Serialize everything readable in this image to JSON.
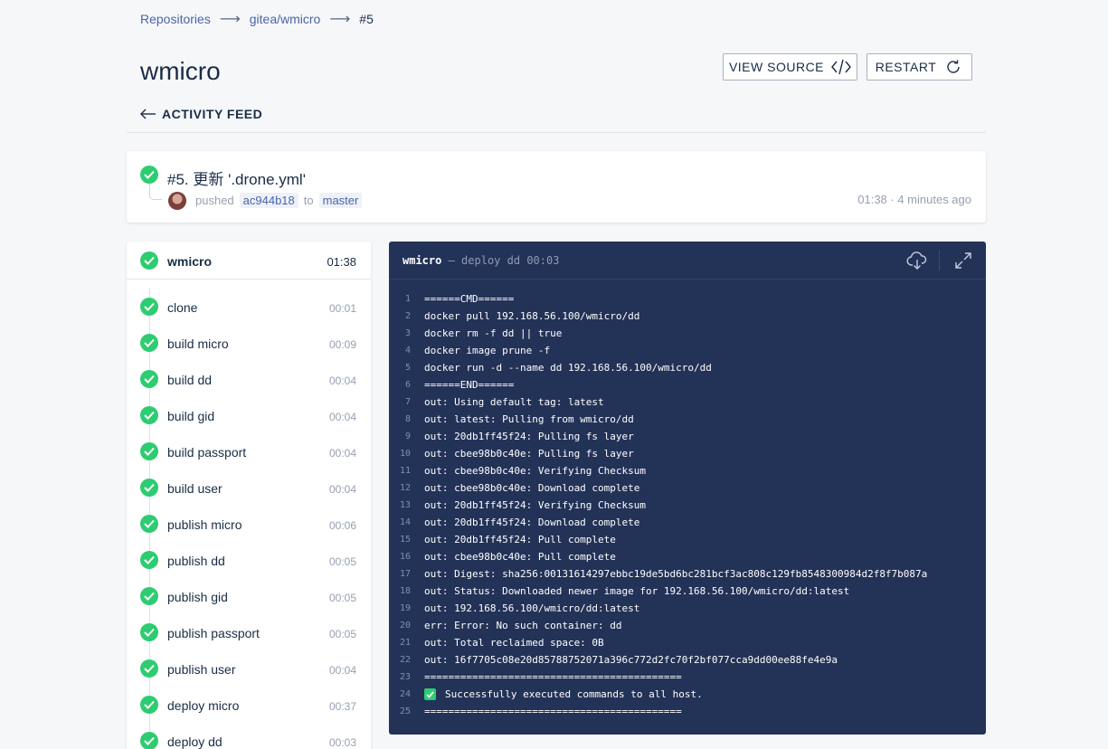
{
  "breadcrumb": {
    "repositories": "Repositories",
    "repo": "gitea/wmicro",
    "build": "#5"
  },
  "repo_name": "wmicro",
  "actions": {
    "view_source": "VIEW SOURCE",
    "restart": "RESTART"
  },
  "back_label": "ACTIVITY FEED",
  "build": {
    "title": "#5. 更新 '.drone.yml'",
    "action": "pushed",
    "commit": "ac944b18",
    "to": "to",
    "branch": "master",
    "duration": "01:38",
    "ago": "4 minutes ago",
    "time_text": "01:38 · 4 minutes ago"
  },
  "stage": {
    "name": "wmicro",
    "duration": "01:38"
  },
  "steps": [
    {
      "name": "clone",
      "duration": "00:01"
    },
    {
      "name": "build micro",
      "duration": "00:09"
    },
    {
      "name": "build dd",
      "duration": "00:04"
    },
    {
      "name": "build gid",
      "duration": "00:04"
    },
    {
      "name": "build passport",
      "duration": "00:04"
    },
    {
      "name": "build user",
      "duration": "00:04"
    },
    {
      "name": "publish micro",
      "duration": "00:06"
    },
    {
      "name": "publish dd",
      "duration": "00:05"
    },
    {
      "name": "publish gid",
      "duration": "00:05"
    },
    {
      "name": "publish passport",
      "duration": "00:05"
    },
    {
      "name": "publish user",
      "duration": "00:04"
    },
    {
      "name": "deploy micro",
      "duration": "00:37"
    },
    {
      "name": "deploy dd",
      "duration": "00:03"
    }
  ],
  "log": {
    "stage": "wmicro",
    "separator": " — ",
    "step": "deploy dd",
    "duration": "00:03",
    "lines": [
      "======CMD======",
      "docker pull 192.168.56.100/wmicro/dd",
      "docker rm -f dd || true",
      "docker image prune -f",
      "docker run -d --name dd 192.168.56.100/wmicro/dd",
      "======END======",
      "out: Using default tag: latest",
      "out: latest: Pulling from wmicro/dd",
      "out: 20db1ff45f24: Pulling fs layer",
      "out: cbee98b0c40e: Pulling fs layer",
      "out: cbee98b0c40e: Verifying Checksum",
      "out: cbee98b0c40e: Download complete",
      "out: 20db1ff45f24: Verifying Checksum",
      "out: 20db1ff45f24: Download complete",
      "out: 20db1ff45f24: Pull complete",
      "out: cbee98b0c40e: Pull complete",
      "out: Digest: sha256:00131614297ebbc19de5bd6bc281bcf3ac808c129fb8548300984d2f8f7b087a",
      "out: Status: Downloaded newer image for 192.168.56.100/wmicro/dd:latest",
      "out: 192.168.56.100/wmicro/dd:latest",
      "err: Error: No such container: dd",
      "out: Total reclaimed space: 0B",
      "out: 16f7705c08e20d85788752071a396c772d2fc70f2bf077cca9dd00ee88fe4e9a",
      "===========================================",
      "Successfully executed commands to all host.",
      "==========================================="
    ],
    "success_line_index": 23
  },
  "colors": {
    "success": "#2ecc71",
    "link": "#4a64a8",
    "log_bg": "#233257",
    "text": "#192d46"
  },
  "icons": [
    "check-icon",
    "code-icon",
    "refresh-icon",
    "arrow-left-icon",
    "cloud-download-icon",
    "expand-icon"
  ]
}
